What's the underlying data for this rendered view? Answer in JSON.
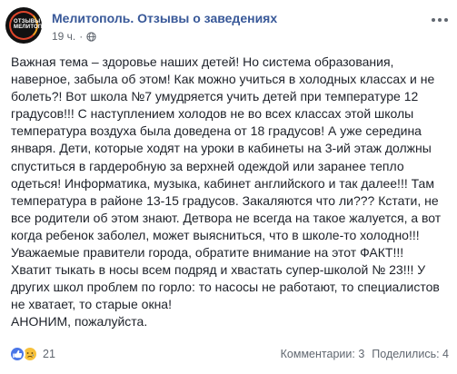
{
  "header": {
    "page_name": "Мелитополь. Отзывы о заведениях",
    "time": "19 ч.",
    "avatar_logo_text": "ОТЗЫВЫ МЕЛИТОПОЛЬ",
    "colors": {
      "page_name": "#385898",
      "meta": "#616770"
    }
  },
  "post": {
    "text": "Важная тема – здоровье наших детей! Но система образования,\nнаверное, забыла об этом! Как можно учиться в холодных классах и не\nболеть?! Вот школа №7 умудряется учить детей при температуре 12\nградусов!!! С наступлением холодов не во всех классах этой школы\nтемпература воздуха была доведена от 18 градусов! А уже середина\nянваря. Дети, которые ходят на уроки в кабинеты на 3-ий этаж должны\nспуститься в гардеробную за верхней одеждой или заранее тепло\nодеться! Информатика, музыка, кабинет английского и так далее!!! Там\nтемпература в районе 13-15 градусов. Закаляются что ли??? Кстати, не\nвсе родители об этом знают. Детвора не всегда на такое жалуется, а вот\nкогда ребенок заболел, может выясниться, что в школе-то холодно!!!\nУважаемые правители города, обратите внимание на этот ФАКТ!!!\nХватит тыкать в носы всем подряд и хвастать супер-школой № 23!!! У\nдругих школ проблем по горло: то насосы не работают, то специалистов\nне хватает, то старые окна!\nАНОНИМ, пожалуйста."
  },
  "footer": {
    "reactions": {
      "icons": [
        "like-icon",
        "sad-icon"
      ],
      "count": "21"
    },
    "comments": "Комментарии: 3",
    "shares": "Поделились: 4"
  }
}
